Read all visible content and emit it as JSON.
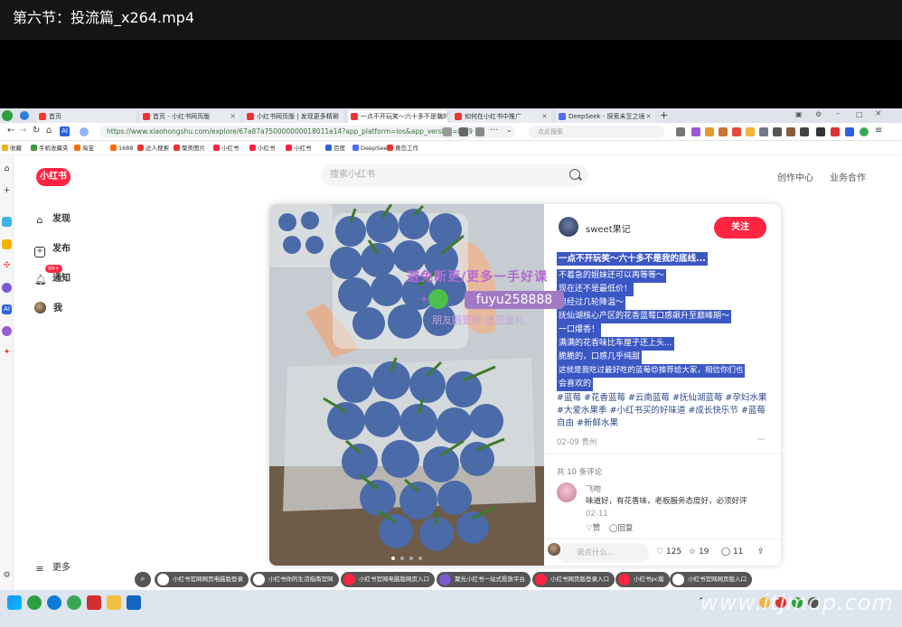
{
  "player": {
    "title": "第六节：投流篇_x264.mp4"
  },
  "browser": {
    "tabs": [
      {
        "label": "首页"
      },
      {
        "label": "首页 - 小红书网页版"
      },
      {
        "label": "小红书网页版 | 发现更多精彩"
      },
      {
        "label": "一点不开玩笑～六十多不是我的底线..."
      },
      {
        "label": "如何在小红书中推广"
      },
      {
        "label": "DeepSeek - 探索未至之境"
      }
    ],
    "url": "https://www.xiaohongshu.com/explore/67a87a750000000018011e14?app_platform=ios&app_version=8.69",
    "search_placeholder": "点此搜索",
    "bookmarks": [
      {
        "label": "收藏",
        "color": "#f0b400"
      },
      {
        "label": "手机收藏夹",
        "color": "#3a9a3a"
      },
      {
        "label": "淘宝",
        "color": "#ff6a00"
      },
      {
        "label": "1688",
        "color": "#ff6a00"
      },
      {
        "label": "达人搜索",
        "color": "#e33"
      },
      {
        "label": "聚美图片",
        "color": "#e33"
      },
      {
        "label": "小红书",
        "color": "#ff2442"
      },
      {
        "label": "小红书",
        "color": "#ff2442"
      },
      {
        "label": "小红书",
        "color": "#ff2442"
      },
      {
        "label": "百度",
        "color": "#2b62e0"
      },
      {
        "label": "DeepSeek",
        "color": "#4d6bfe"
      },
      {
        "label": "黄岛工作",
        "color": "#e33"
      }
    ]
  },
  "xhs": {
    "logo": "小红书",
    "search_placeholder": "搜索小红书",
    "header_links": [
      "创作中心",
      "业务合作"
    ],
    "nav": [
      {
        "label": "发现",
        "icon": "home-icon"
      },
      {
        "label": "发布",
        "icon": "plus-square-icon"
      },
      {
        "label": "通知",
        "icon": "bell-icon"
      },
      {
        "label": "我",
        "icon": "avatar"
      }
    ],
    "notify_badge": "99+",
    "more": "更多",
    "note": {
      "author": "sweet果记",
      "follow": "关注",
      "title": "一点不开玩笑～六十多不是我的底线...",
      "body_lines": [
        "不着急的姐妹还可以再等等～",
        "现在还不是最低价！",
        "但经过几轮降温～",
        "抚仙湖核心产区的花香蓝莓口感飙升至巅峰期～",
        "一口爆香！",
        "满满的花香味比车厘子还上头...",
        "脆脆的，口感几乎纯甜",
        "这就是我吃过最好吃的蓝莓😍推荐给大家，相信你们也",
        "会喜欢的"
      ],
      "tags": "#蓝莓 #花香蓝莓 #云南蓝莓 #抚仙湖蓝莓 #孕妇水果 #大爱水果季 #小红书买的好味道 #成长快乐节 #蓝莓自由 #新鲜水果",
      "date": "02-09 贵州",
      "more_dots": "···",
      "comment_count": "共 10 条评论",
      "comment": {
        "user": "飞吻",
        "text": "味道好，有花香味，老板服务态度好，必须好评",
        "date": "02-11",
        "likes": "赞",
        "reply": "回复"
      },
      "comment_placeholder": "说点什么...",
      "likes": "125",
      "stars": "19",
      "comments": "11"
    }
  },
  "watermark": {
    "line1": "避免断更/更多一手好课",
    "wechat": "fuyu258888",
    "line3": "朋友圈更新 送见面礼"
  },
  "quick_links": [
    "小红书官网网页电脑版登录",
    "小红书你的生活指南官网",
    "小红书官网电脑版网页入口",
    "聚光小红书一站式投放平台",
    "小红书网页版登录入口",
    "小红书pc版",
    "小红书官网网页版入口"
  ],
  "site_watermark": "www.itjmop.com"
}
